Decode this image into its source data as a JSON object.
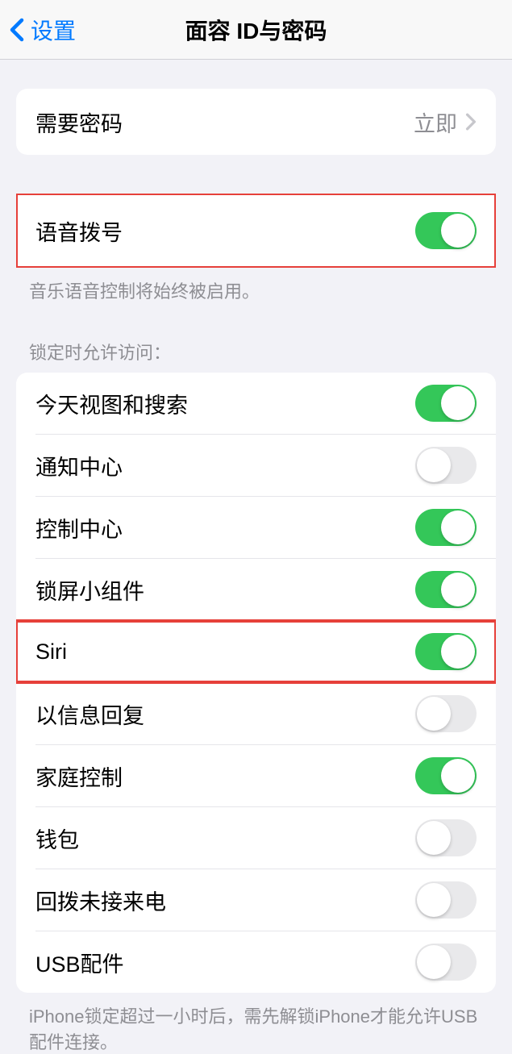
{
  "nav": {
    "back_label": "设置",
    "title": "面容 ID与密码"
  },
  "passcode_row": {
    "label": "需要密码",
    "value": "立即"
  },
  "voice_dial": {
    "label": "语音拨号",
    "footer": "音乐语音控制将始终被启用。",
    "on": true
  },
  "lock_section": {
    "header": "锁定时允许访问：",
    "items": [
      {
        "label": "今天视图和搜索",
        "on": true
      },
      {
        "label": "通知中心",
        "on": false
      },
      {
        "label": "控制中心",
        "on": true
      },
      {
        "label": "锁屏小组件",
        "on": true
      },
      {
        "label": "Siri",
        "on": true
      },
      {
        "label": "以信息回复",
        "on": false
      },
      {
        "label": "家庭控制",
        "on": true
      },
      {
        "label": "钱包",
        "on": false
      },
      {
        "label": "回拨未接来电",
        "on": false
      },
      {
        "label": "USB配件",
        "on": false
      }
    ],
    "footer": "iPhone锁定超过一小时后，需先解锁iPhone才能允许USB配件连接。"
  }
}
